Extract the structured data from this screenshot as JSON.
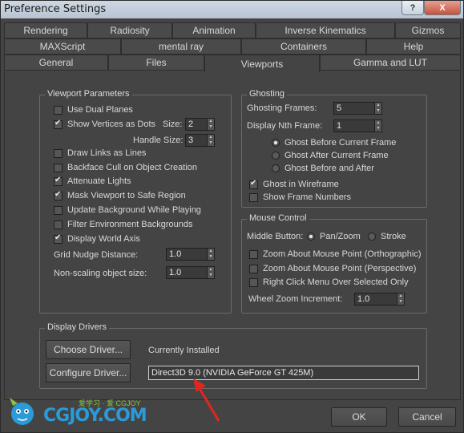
{
  "window": {
    "title": "Preference Settings",
    "help_btn": "?",
    "close_btn": "X"
  },
  "tabs": {
    "row1": [
      "Rendering",
      "Radiosity",
      "Animation",
      "Inverse Kinematics",
      "Gizmos"
    ],
    "row2": [
      "MAXScript",
      "mental ray",
      "Containers",
      "Help"
    ],
    "row3": [
      "General",
      "Files",
      "Viewports",
      "Gamma and LUT"
    ],
    "active": "Viewports"
  },
  "viewport_params": {
    "legend": "Viewport Parameters",
    "use_dual_planes": {
      "label": "Use Dual Planes",
      "checked": false
    },
    "show_vertices": {
      "label": "Show Vertices as Dots",
      "checked": true
    },
    "size_label": "Size:",
    "size_value": "2",
    "handle_size_label": "Handle Size:",
    "handle_size_value": "3",
    "draw_links": {
      "label": "Draw Links as Lines",
      "checked": false
    },
    "backface_cull": {
      "label": "Backface Cull on Object Creation",
      "checked": false
    },
    "attenuate_lights": {
      "label": "Attenuate Lights",
      "checked": true
    },
    "mask_viewport": {
      "label": "Mask Viewport to Safe Region",
      "checked": true
    },
    "update_background": {
      "label": "Update Background While Playing",
      "checked": false
    },
    "filter_env": {
      "label": "Filter Environment Backgrounds",
      "checked": false
    },
    "display_world_axis": {
      "label": "Display World Axis",
      "checked": true
    },
    "grid_nudge_label": "Grid Nudge Distance:",
    "grid_nudge_value": "1.0",
    "non_scaling_label": "Non-scaling object size:",
    "non_scaling_value": "1.0"
  },
  "ghosting": {
    "legend": "Ghosting",
    "frames_label": "Ghosting Frames:",
    "frames_value": "5",
    "nth_label": "Display Nth Frame:",
    "nth_value": "1",
    "radio_before": "Ghost Before Current Frame",
    "radio_after": "Ghost After Current Frame",
    "radio_both": "Ghost Before and After",
    "selected": "before",
    "wireframe": {
      "label": "Ghost in Wireframe",
      "checked": true
    },
    "frame_numbers": {
      "label": "Show Frame Numbers",
      "checked": false
    }
  },
  "mouse_control": {
    "legend": "Mouse Control",
    "middle_label": "Middle Button:",
    "pan_zoom": "Pan/Zoom",
    "stroke": "Stroke",
    "middle_selected": "pan_zoom",
    "zoom_ortho": {
      "label": "Zoom About Mouse Point (Orthographic)",
      "checked": false
    },
    "zoom_persp": {
      "label": "Zoom About Mouse Point (Perspective)",
      "checked": false
    },
    "right_click": {
      "label": "Right Click Menu Over Selected Only",
      "checked": false
    },
    "wheel_label": "Wheel Zoom Increment:",
    "wheel_value": "1.0"
  },
  "display_drivers": {
    "legend": "Display Drivers",
    "choose_btn": "Choose Driver...",
    "currently_installed": "Currently Installed",
    "configure_btn": "Configure Driver...",
    "driver_name": "Direct3D 9.0 (NVIDIA GeForce GT 425M)"
  },
  "footer": {
    "ok": "OK",
    "cancel": "Cancel"
  },
  "watermark": {
    "brand": "CGJOY.COM",
    "tagline_cn": "爱学习 · 爱 CGJOY"
  },
  "colors": {
    "bg": "#444444",
    "annotation_arrow": "#e0261f",
    "watermark_blue": "#2a9bd8",
    "watermark_green": "#8cc63f"
  }
}
